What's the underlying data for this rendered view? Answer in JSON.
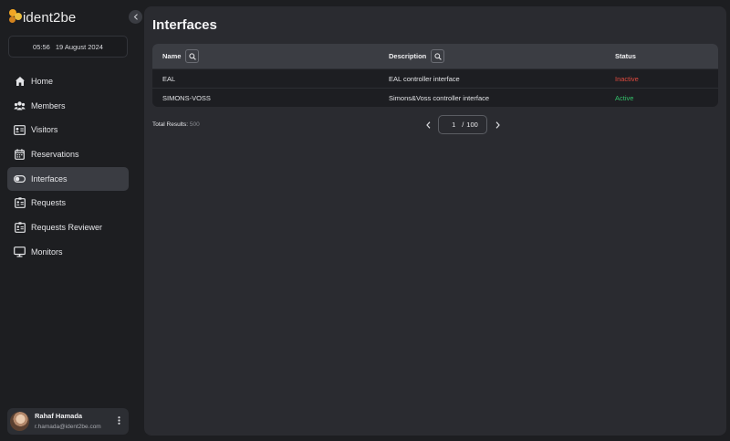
{
  "app": {
    "logo_text": "ident2be"
  },
  "clock": {
    "time": "05:56",
    "date": "19 August 2024"
  },
  "nav": {
    "items": [
      {
        "label": "Home",
        "icon": "home-icon"
      },
      {
        "label": "Members",
        "icon": "members-icon"
      },
      {
        "label": "Visitors",
        "icon": "visitors-icon"
      },
      {
        "label": "Reservations",
        "icon": "calendar-icon"
      },
      {
        "label": "Interfaces",
        "icon": "toggle-icon",
        "active": true
      },
      {
        "label": "Requests",
        "icon": "id-card-icon"
      },
      {
        "label": "Requests Reviewer",
        "icon": "id-card-icon"
      },
      {
        "label": "Monitors",
        "icon": "monitor-icon"
      }
    ]
  },
  "user": {
    "name": "Rahaf Hamada",
    "email": "r.hamada@ident2be.com"
  },
  "page": {
    "title": "Interfaces"
  },
  "table": {
    "columns": {
      "name": "Name",
      "description": "Description",
      "status": "Status"
    },
    "rows": [
      {
        "name": "EAL",
        "description": "EAL controller interface",
        "status": "Inactive"
      },
      {
        "name": "SIMONS-VOSS",
        "description": "Simons&Voss controller interface",
        "status": "Active"
      }
    ]
  },
  "footer": {
    "total_label": "Total Results:",
    "total_count": "500"
  },
  "pagination": {
    "current": "1",
    "separator": "/",
    "total": "100"
  },
  "colors": {
    "inactive": "#e04a3f",
    "active": "#33c16a",
    "accent": "#f2a623"
  }
}
